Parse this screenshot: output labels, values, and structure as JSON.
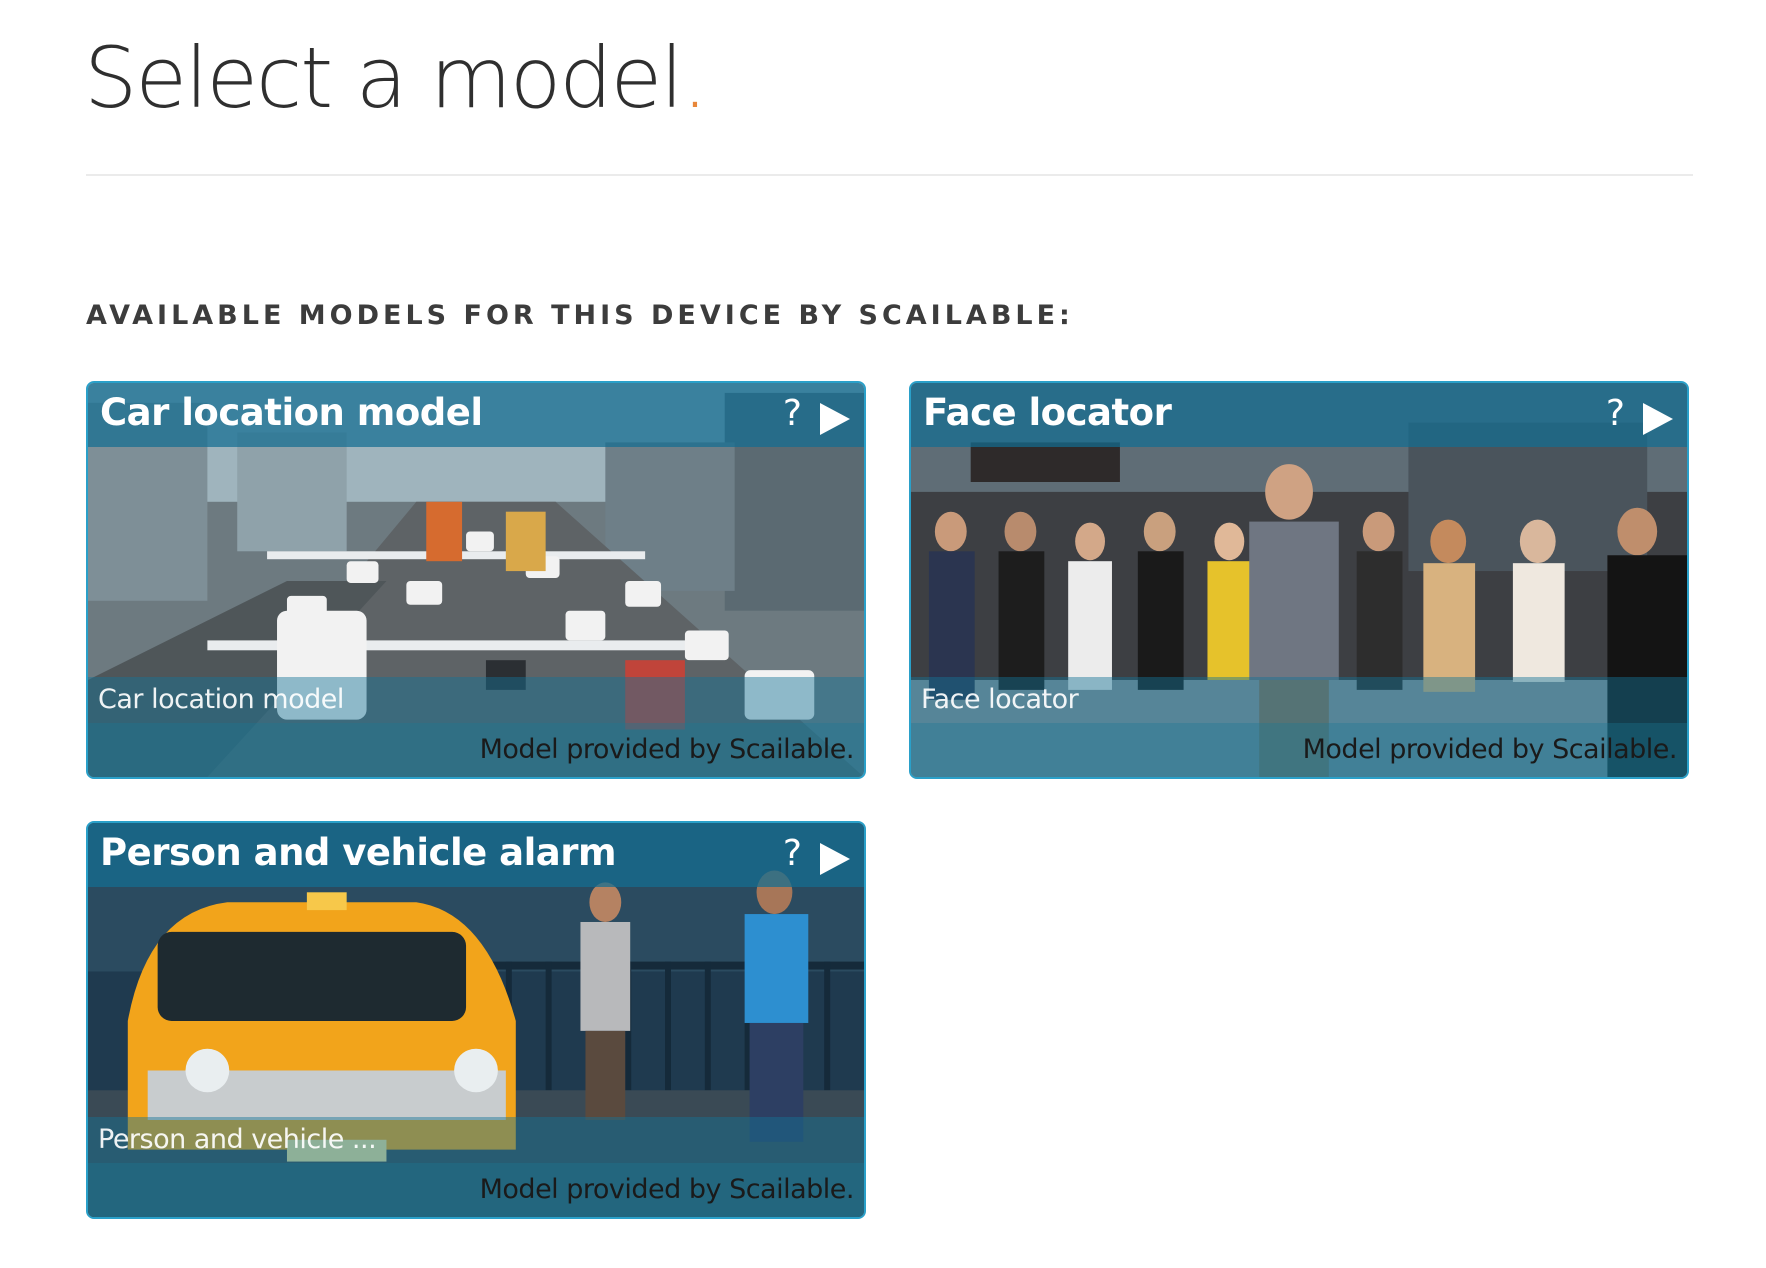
{
  "page": {
    "title": "Select a model",
    "title_dot": ".",
    "accent_color": "#e8873a"
  },
  "section": {
    "heading": "AVAILABLE MODELS FOR THIS DEVICE BY SCAILABLE:"
  },
  "cards": [
    {
      "title": "Car location model",
      "help": "?",
      "subtitle": "Car location model",
      "provider": "Model provided by Scailable.",
      "image_subject": "city intersection with traffic"
    },
    {
      "title": "Face locator",
      "help": "?",
      "subtitle": "Face locator",
      "provider": "Model provided by Scailable.",
      "image_subject": "crowd of pedestrians on street"
    },
    {
      "title": "Person and vehicle alarm",
      "help": "?",
      "subtitle": "Person and vehicle ...",
      "provider": "Model provided by Scailable.",
      "image_subject": "yellow taxi and pedestrian"
    }
  ],
  "colors": {
    "card_border": "#2aa0c9",
    "card_header": "#146e91"
  },
  "icons": {
    "help": "question-mark-icon",
    "open": "play-icon"
  }
}
